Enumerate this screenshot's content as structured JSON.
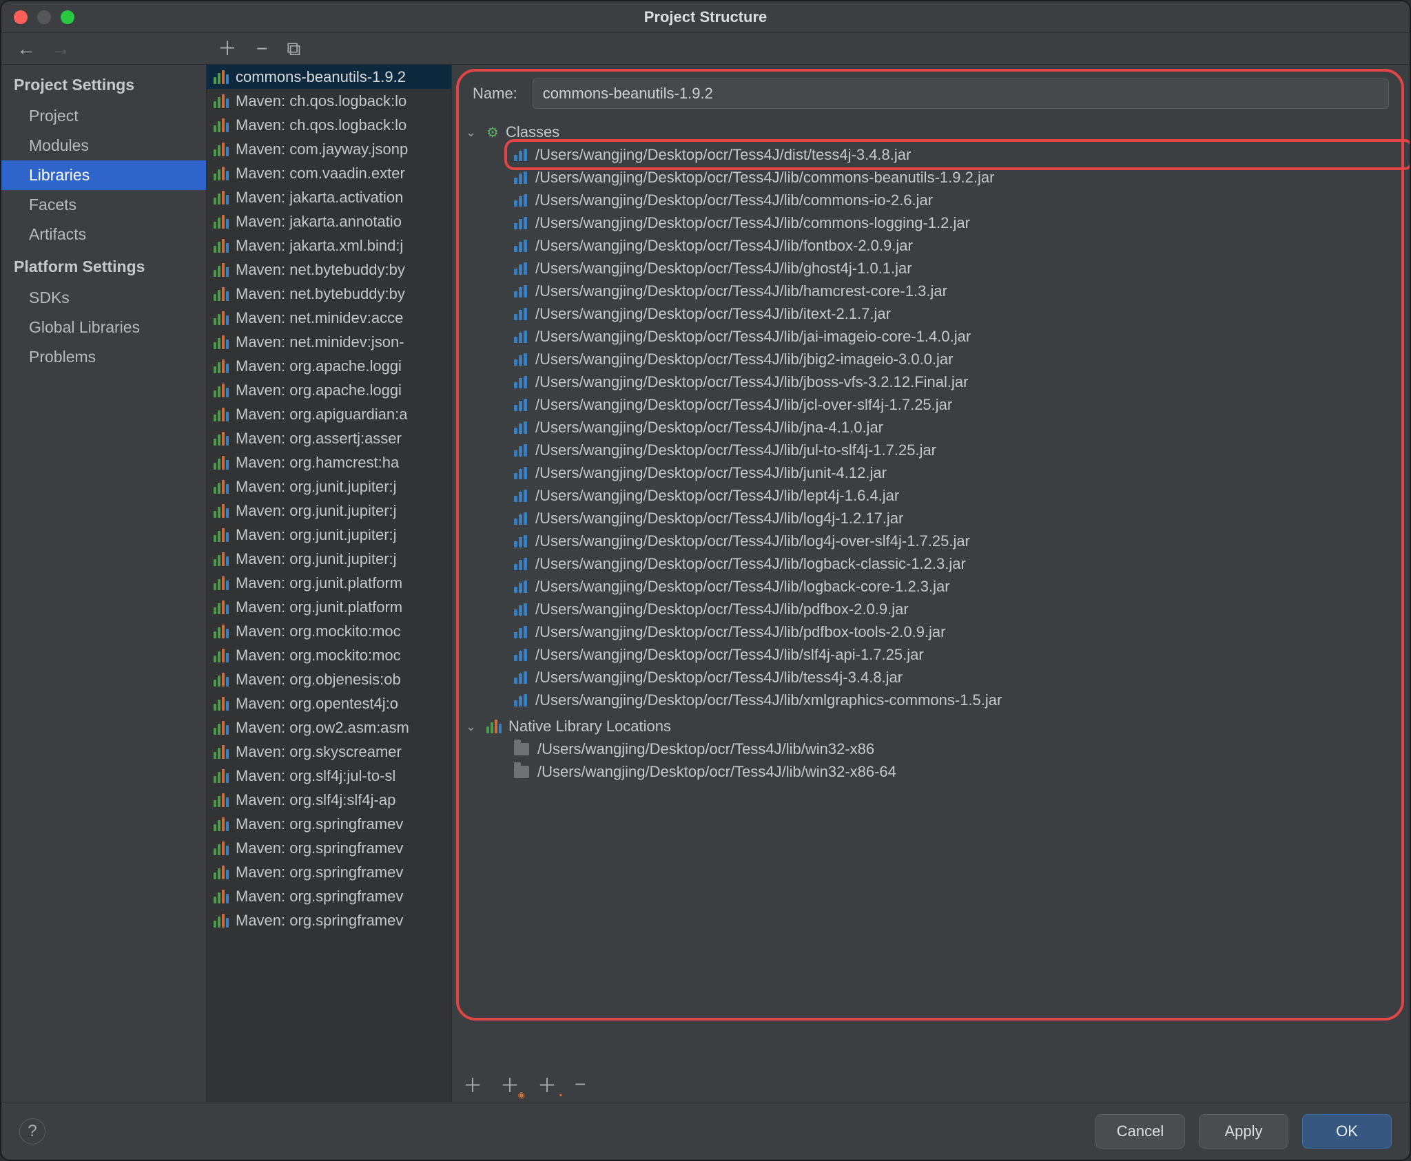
{
  "window": {
    "title": "Project Structure"
  },
  "sidebar": {
    "groups": [
      {
        "heading": "Project Settings",
        "items": [
          "Project",
          "Modules",
          "Libraries",
          "Facets",
          "Artifacts"
        ],
        "selected": "Libraries"
      },
      {
        "heading": "Platform Settings",
        "items": [
          "SDKs",
          "Global Libraries"
        ]
      },
      {
        "heading": "",
        "items": [
          "Problems"
        ]
      }
    ]
  },
  "library_list": {
    "selected_index": 0,
    "items": [
      "commons-beanutils-1.9.2",
      "Maven: ch.qos.logback:lo",
      "Maven: ch.qos.logback:lo",
      "Maven: com.jayway.jsonp",
      "Maven: com.vaadin.exter",
      "Maven: jakarta.activation",
      "Maven: jakarta.annotatio",
      "Maven: jakarta.xml.bind:j",
      "Maven: net.bytebuddy:by",
      "Maven: net.bytebuddy:by",
      "Maven: net.minidev:acce",
      "Maven: net.minidev:json-",
      "Maven: org.apache.loggi",
      "Maven: org.apache.loggi",
      "Maven: org.apiguardian:a",
      "Maven: org.assertj:asser",
      "Maven: org.hamcrest:ha",
      "Maven: org.junit.jupiter:j",
      "Maven: org.junit.jupiter:j",
      "Maven: org.junit.jupiter:j",
      "Maven: org.junit.jupiter:j",
      "Maven: org.junit.platform",
      "Maven: org.junit.platform",
      "Maven: org.mockito:moc",
      "Maven: org.mockito:moc",
      "Maven: org.objenesis:ob",
      "Maven: org.opentest4j:o",
      "Maven: org.ow2.asm:asm",
      "Maven: org.skyscreamer",
      "Maven: org.slf4j:jul-to-sl",
      "Maven: org.slf4j:slf4j-ap",
      "Maven: org.springframev",
      "Maven: org.springframev",
      "Maven: org.springframev",
      "Maven: org.springframev",
      "Maven: org.springframev"
    ]
  },
  "detail": {
    "name_label": "Name:",
    "name_value": "commons-beanutils-1.9.2",
    "groups": [
      {
        "label": "Classes",
        "icon": "class",
        "items": [
          "/Users/wangjing/Desktop/ocr/Tess4J/dist/tess4j-3.4.8.jar",
          "/Users/wangjing/Desktop/ocr/Tess4J/lib/commons-beanutils-1.9.2.jar",
          "/Users/wangjing/Desktop/ocr/Tess4J/lib/commons-io-2.6.jar",
          "/Users/wangjing/Desktop/ocr/Tess4J/lib/commons-logging-1.2.jar",
          "/Users/wangjing/Desktop/ocr/Tess4J/lib/fontbox-2.0.9.jar",
          "/Users/wangjing/Desktop/ocr/Tess4J/lib/ghost4j-1.0.1.jar",
          "/Users/wangjing/Desktop/ocr/Tess4J/lib/hamcrest-core-1.3.jar",
          "/Users/wangjing/Desktop/ocr/Tess4J/lib/itext-2.1.7.jar",
          "/Users/wangjing/Desktop/ocr/Tess4J/lib/jai-imageio-core-1.4.0.jar",
          "/Users/wangjing/Desktop/ocr/Tess4J/lib/jbig2-imageio-3.0.0.jar",
          "/Users/wangjing/Desktop/ocr/Tess4J/lib/jboss-vfs-3.2.12.Final.jar",
          "/Users/wangjing/Desktop/ocr/Tess4J/lib/jcl-over-slf4j-1.7.25.jar",
          "/Users/wangjing/Desktop/ocr/Tess4J/lib/jna-4.1.0.jar",
          "/Users/wangjing/Desktop/ocr/Tess4J/lib/jul-to-slf4j-1.7.25.jar",
          "/Users/wangjing/Desktop/ocr/Tess4J/lib/junit-4.12.jar",
          "/Users/wangjing/Desktop/ocr/Tess4J/lib/lept4j-1.6.4.jar",
          "/Users/wangjing/Desktop/ocr/Tess4J/lib/log4j-1.2.17.jar",
          "/Users/wangjing/Desktop/ocr/Tess4J/lib/log4j-over-slf4j-1.7.25.jar",
          "/Users/wangjing/Desktop/ocr/Tess4J/lib/logback-classic-1.2.3.jar",
          "/Users/wangjing/Desktop/ocr/Tess4J/lib/logback-core-1.2.3.jar",
          "/Users/wangjing/Desktop/ocr/Tess4J/lib/pdfbox-2.0.9.jar",
          "/Users/wangjing/Desktop/ocr/Tess4J/lib/pdfbox-tools-2.0.9.jar",
          "/Users/wangjing/Desktop/ocr/Tess4J/lib/slf4j-api-1.7.25.jar",
          "/Users/wangjing/Desktop/ocr/Tess4J/lib/tess4j-3.4.8.jar",
          "/Users/wangjing/Desktop/ocr/Tess4J/lib/xmlgraphics-commons-1.5.jar"
        ]
      },
      {
        "label": "Native Library Locations",
        "icon": "native",
        "items": [
          "/Users/wangjing/Desktop/ocr/Tess4J/lib/win32-x86",
          "/Users/wangjing/Desktop/ocr/Tess4J/lib/win32-x86-64"
        ]
      }
    ]
  },
  "footer": {
    "cancel": "Cancel",
    "apply": "Apply",
    "ok": "OK"
  }
}
